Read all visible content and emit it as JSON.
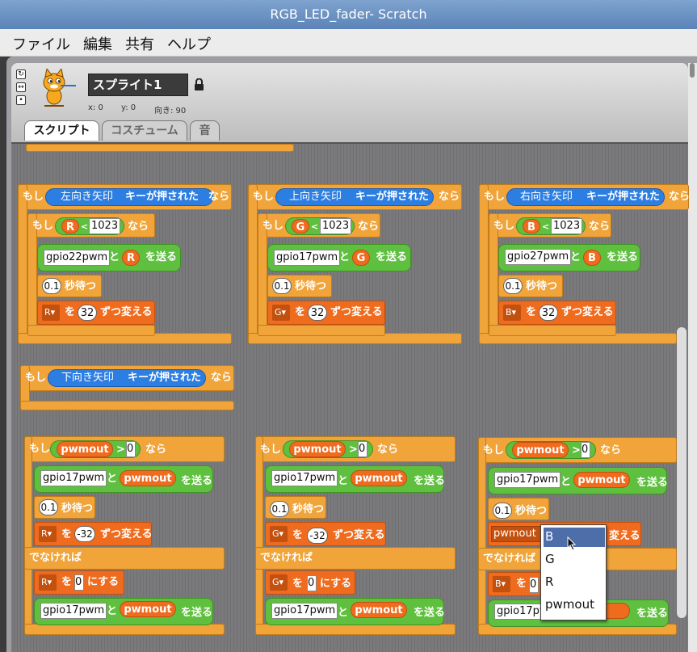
{
  "window": {
    "title": "RGB_LED_fader- Scratch"
  },
  "menu": [
    {
      "label": "ファイル"
    },
    {
      "label": "編集"
    },
    {
      "label": "共有"
    },
    {
      "label": "ヘルプ"
    }
  ],
  "sprite": {
    "name": "スプライト1",
    "x_label": "x: 0",
    "y_label": "y: 0",
    "dir_label": "向き: 90"
  },
  "tabs": [
    {
      "label": "スクリプト"
    },
    {
      "label": "コスチューム"
    },
    {
      "label": "音"
    }
  ],
  "blocks": {
    "if": "もし",
    "then": "なら",
    "else": "でなければ",
    "key_pressed": "キーが押された",
    "left_arrow": "左向き矢印",
    "up_arrow": "上向き矢印",
    "right_arrow": "右向き矢印",
    "down_arrow": "下向き矢印",
    "lt": "<",
    "gt": ">",
    "limit": "1023",
    "zero": "0",
    "and": "と",
    "send": "を送る",
    "wait_value": "0.1",
    "wait": "秒待つ",
    "change_o": "を",
    "change_by": "ずつ変える",
    "set_to": "にする",
    "step_up": "32",
    "step_down": "-32",
    "pwmout": "pwmout",
    "gpio22": "gpio22pwm",
    "gpio17": "gpio17pwm",
    "gpio27": "gpio27pwm",
    "var_r": "R",
    "var_g": "G",
    "var_b": "B"
  },
  "dropdown": {
    "items": [
      {
        "label": "B"
      },
      {
        "label": "G"
      },
      {
        "label": "R"
      },
      {
        "label": "pwmout"
      }
    ],
    "selected": "B"
  },
  "colors": {
    "control": "#f0a43a",
    "sensing": "#2d7ee2",
    "operator": "#5fbf3f",
    "variable": "#ef6b1e",
    "highlight": "#4d6ea9"
  }
}
